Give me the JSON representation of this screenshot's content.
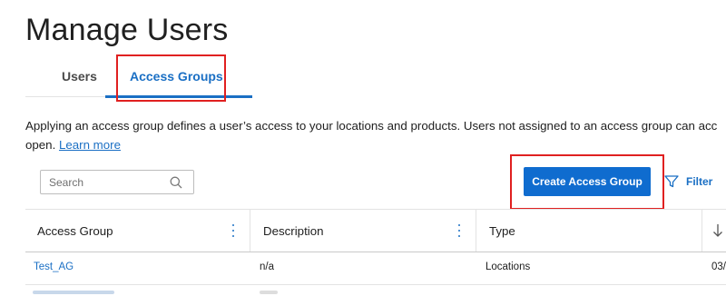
{
  "page": {
    "title": "Manage Users"
  },
  "tabs": [
    {
      "label": "Users",
      "active": false
    },
    {
      "label": "Access Groups",
      "active": true
    }
  ],
  "description": {
    "text": "Applying an access group defines a user’s access to your locations and products. Users not assigned to an access group can acc",
    "text_line2": "open.",
    "link": "Learn more"
  },
  "search": {
    "placeholder": "Search",
    "value": ""
  },
  "toolbar": {
    "create_label": "Create Access Group",
    "filter_label": "Filter"
  },
  "table": {
    "columns": [
      "Access Group",
      "Description",
      "Type",
      ""
    ],
    "rows": [
      {
        "access_group": "Test_AG",
        "description": "n/a",
        "type": "Locations",
        "date": "03/"
      }
    ]
  },
  "colors": {
    "accent": "#0f6ccf",
    "highlight": "#e02020",
    "link": "#1a6fc4"
  },
  "icons": {
    "search": "search-icon",
    "filter": "filter-icon",
    "sort": "arrow-down-icon",
    "column_menu": "kebab-menu-icon"
  }
}
